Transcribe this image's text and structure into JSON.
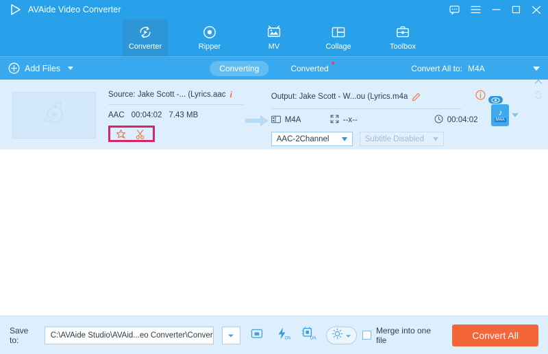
{
  "window": {
    "app_title": "AVAide Video Converter",
    "logo_icon": "play-triangle-icon",
    "buttons": [
      {
        "name": "feedback",
        "icon": "speech-bubble-icon"
      },
      {
        "name": "menu",
        "icon": "hamburger-menu-icon"
      },
      {
        "name": "minimize",
        "icon": "minimize-icon"
      },
      {
        "name": "maximize",
        "icon": "maximize-icon"
      },
      {
        "name": "close",
        "icon": "close-icon"
      }
    ],
    "accent_blue": "#29a0ea",
    "accent_orange": "#f4663a",
    "highlight_pink": "#d6246a"
  },
  "nav": {
    "tabs": [
      {
        "id": "converter",
        "label": "Converter",
        "icon": "convert-circular-arrow-icon",
        "active": true
      },
      {
        "id": "ripper",
        "label": "Ripper",
        "icon": "disc-icon",
        "active": false
      },
      {
        "id": "mv",
        "label": "MV",
        "icon": "tv-photo-icon",
        "active": false
      },
      {
        "id": "collage",
        "label": "Collage",
        "icon": "collage-grid-icon",
        "active": false
      },
      {
        "id": "toolbox",
        "label": "Toolbox",
        "icon": "toolbox-icon",
        "active": false
      }
    ]
  },
  "actionbar": {
    "add_files_label": "Add Files",
    "add_files_icon": "plus-circle-icon",
    "segments": [
      {
        "id": "converting",
        "label": "Converting",
        "active": true,
        "dot": false
      },
      {
        "id": "converted",
        "label": "Converted",
        "active": false,
        "dot": true
      }
    ],
    "convert_all_to_label": "Convert All to:",
    "convert_all_to_value": "M4A"
  },
  "file_row": {
    "thumbnail_icon": "music-note-play-icon",
    "source": {
      "label": "Source: Jake Scott -... (Lyrics.aac",
      "info_icon": "info-icon",
      "codec": "AAC",
      "duration": "00:04:02",
      "size": "7.43 MB",
      "tools": [
        {
          "name": "edit-effects",
          "icon": "magic-wand-star-icon"
        },
        {
          "name": "trim",
          "icon": "scissors-icon"
        }
      ],
      "tools_highlighted": true
    },
    "output": {
      "label": "Output: Jake Scott - W...ou (Lyrics.m4a",
      "edit_icon": "pencil-edit-icon",
      "info_icon": "info-circle-icon",
      "format": "M4A",
      "format_icon": "film-strip-icon",
      "resolution": "--x--",
      "resolution_icon": "resize-arrows-icon",
      "duration": "00:04:02",
      "duration_icon": "clock-icon",
      "audio_track": "AAC-2Channel",
      "subtitle_track": "Subtitle Disabled",
      "subtitle_disabled": true,
      "badge_label": "M4A",
      "badge_icon": "music-note-icon",
      "preview_icon": "eye-icon"
    },
    "row_controls": [
      {
        "name": "remove-file",
        "icon": "close-icon"
      },
      {
        "name": "reorder",
        "icon": "chevron-updown-icon"
      }
    ],
    "arrow_icon": "right-arrow-icon"
  },
  "bottombar": {
    "save_to_label": "Save to:",
    "save_to_path": "C:\\AVAide Studio\\AVAid...eo Converter\\Converted",
    "buttons": [
      {
        "name": "open-folder",
        "icon": "folder-open-icon"
      },
      {
        "name": "hardware-acceleration",
        "icon": "lightning-on-icon",
        "state": "ON"
      },
      {
        "name": "gpu-acceleration",
        "icon": "gpu-chip-on-icon",
        "state": "ON"
      },
      {
        "name": "preferences",
        "icon": "gear-icon"
      }
    ],
    "merge_label": "Merge into one file",
    "merge_checked": false,
    "convert_all_label": "Convert All"
  }
}
